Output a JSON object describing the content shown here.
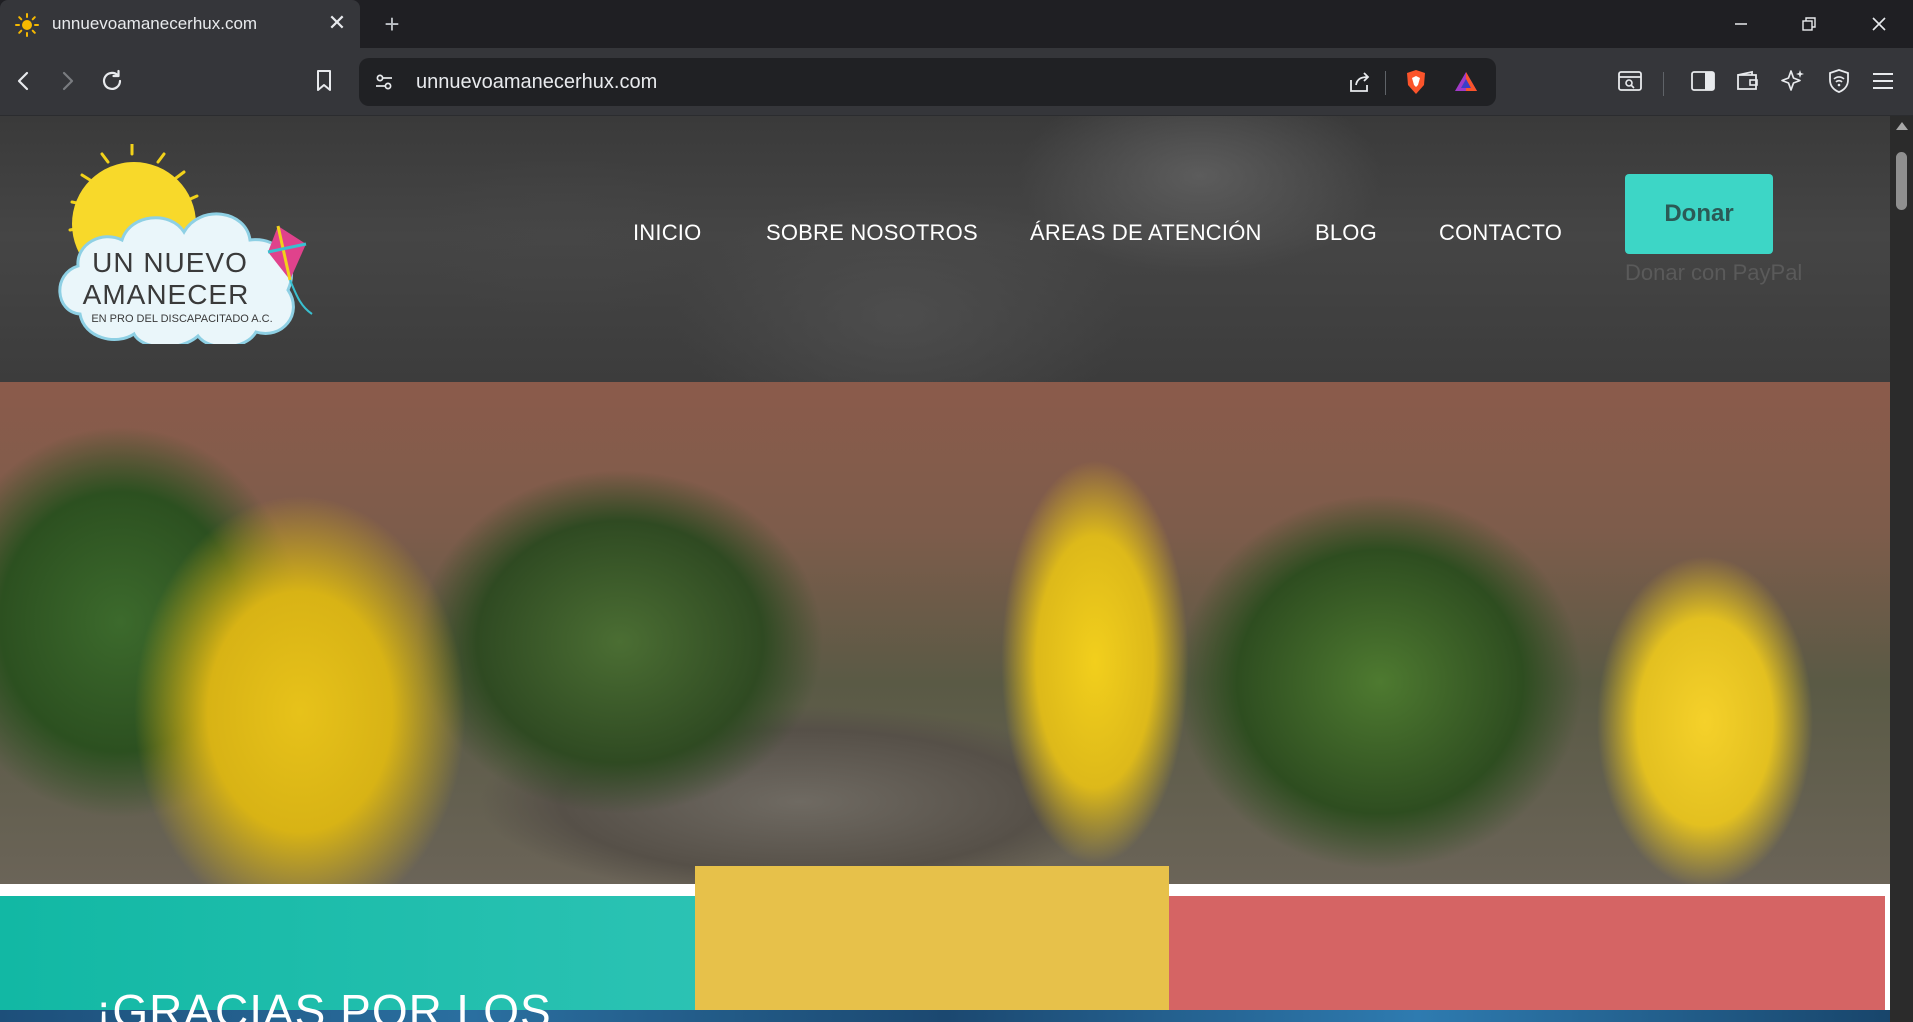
{
  "browser": {
    "tab": {
      "title": "unnuevoamanecerhux.com",
      "favicon": "sun-icon"
    },
    "address_bar": {
      "url": "unnuevoamanecerhux.com"
    },
    "icons": [
      "back-icon",
      "forward-icon",
      "reload-icon",
      "bookmark-icon",
      "site-settings-icon",
      "share-icon",
      "brave-shields-icon",
      "brave-rewards-icon",
      "reader-mode-icon",
      "sidebar-icon",
      "wallet-icon",
      "leo-ai-icon",
      "vpn-icon",
      "menu-icon",
      "minimize-icon",
      "restore-icon",
      "close-icon",
      "new-tab-icon"
    ]
  },
  "site": {
    "logo": {
      "line1": "UN NUEVO",
      "line2": "AMANECER",
      "tagline": "EN PRO DEL DISCAPACITADO A.C."
    },
    "nav": [
      {
        "label": "INICIO"
      },
      {
        "label": "SOBRE NOSOTROS"
      },
      {
        "label": "ÁREAS DE ATENCIÓN"
      },
      {
        "label": "BLOG"
      },
      {
        "label": "CONTACTO"
      }
    ],
    "donate_label": "Donar",
    "paypal_label": "Donar con PayPal",
    "section_heading": "¡GRACIAS POR LOS"
  },
  "colors": {
    "teal": "#3dd6c6",
    "yellow": "#e7c14a",
    "red": "#d56464"
  }
}
